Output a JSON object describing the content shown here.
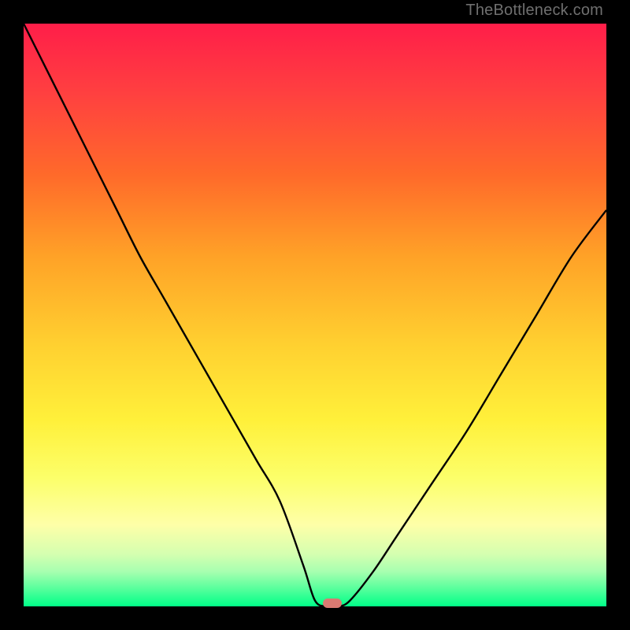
{
  "watermark": "TheBottleneck.com",
  "colors": {
    "gradient_top": "#ff1e49",
    "gradient_bottom": "#00ff88",
    "curve": "#000000",
    "marker": "#d97a72",
    "frame": "#000000"
  },
  "chart_data": {
    "type": "line",
    "title": "",
    "xlabel": "",
    "ylabel": "",
    "xlim": [
      0,
      100
    ],
    "ylim": [
      0,
      100
    ],
    "series": [
      {
        "name": "bottleneck-curve",
        "x": [
          0,
          4,
          8,
          12,
          16,
          20,
          24,
          28,
          32,
          36,
          40,
          44,
          48,
          50,
          52,
          54,
          56,
          60,
          64,
          70,
          76,
          82,
          88,
          94,
          100
        ],
        "y": [
          100,
          92,
          84,
          76,
          68,
          60,
          53,
          46,
          39,
          32,
          25,
          18,
          7,
          1,
          0,
          0,
          1,
          6,
          12,
          21,
          30,
          40,
          50,
          60,
          68
        ]
      }
    ],
    "annotations": [
      {
        "name": "optimum-marker",
        "x": 53,
        "y": 0.5
      }
    ],
    "grid": false,
    "legend": false
  }
}
